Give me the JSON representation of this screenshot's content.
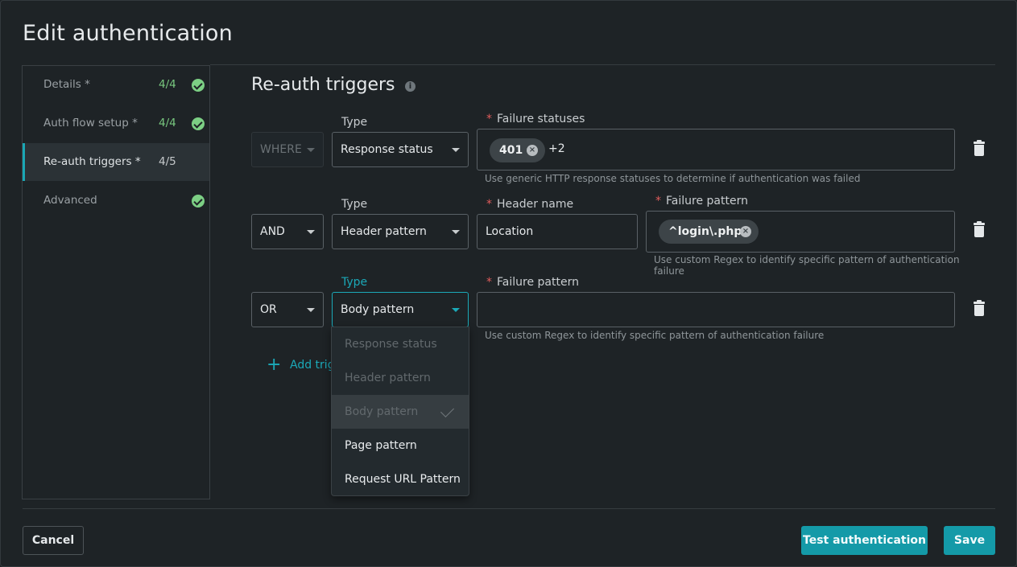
{
  "dialog": {
    "title": "Edit authentication"
  },
  "sidebar": {
    "items": [
      {
        "label": "Details *",
        "count": "4/4",
        "complete": true,
        "active": false
      },
      {
        "label": "Auth flow setup *",
        "count": "4/4",
        "complete": true,
        "active": false
      },
      {
        "label": "Re-auth triggers *",
        "count": "4/5",
        "complete": false,
        "active": true
      },
      {
        "label": "Advanced",
        "count": "",
        "complete": true,
        "active": false
      }
    ]
  },
  "section": {
    "title": "Re-auth triggers",
    "info_icon": "info-icon"
  },
  "triggers": [
    {
      "operator": "WHERE",
      "operator_disabled": true,
      "type_label": "Type",
      "type": "Response status",
      "field_label": "Failure statuses",
      "chip": "401",
      "more": "+2",
      "helper": "Use generic HTTP response statuses to determine if authentication was failed"
    },
    {
      "operator": "AND",
      "type_label": "Type",
      "type": "Header pattern",
      "header_label": "Header name",
      "header_value": "Location",
      "field_label": "Failure pattern",
      "chip": "^login\\.php$",
      "helper_line1": "Use custom Regex to identify specific pattern of authentication",
      "helper_line2": "failure"
    },
    {
      "operator": "OR",
      "type_label": "Type",
      "type": "Body pattern",
      "field_label": "Failure pattern",
      "field_value": "",
      "helper": "Use custom Regex to identify specific pattern of authentication failure"
    }
  ],
  "add_trigger": {
    "label": "Add trig"
  },
  "type_dropdown": {
    "options": [
      {
        "label": "Response status",
        "disabled": true
      },
      {
        "label": "Header pattern",
        "disabled": true
      },
      {
        "label": "Body pattern",
        "disabled": true,
        "selected": true
      },
      {
        "label": "Page pattern",
        "disabled": false
      },
      {
        "label": "Request URL Pattern",
        "disabled": false
      }
    ]
  },
  "footer": {
    "cancel": "Cancel",
    "test": "Test authentication",
    "save": "Save"
  },
  "colors": {
    "accent": "#149aa8",
    "success": "#7ccf84",
    "required": "#e05c5c",
    "background": "#1e2326"
  }
}
